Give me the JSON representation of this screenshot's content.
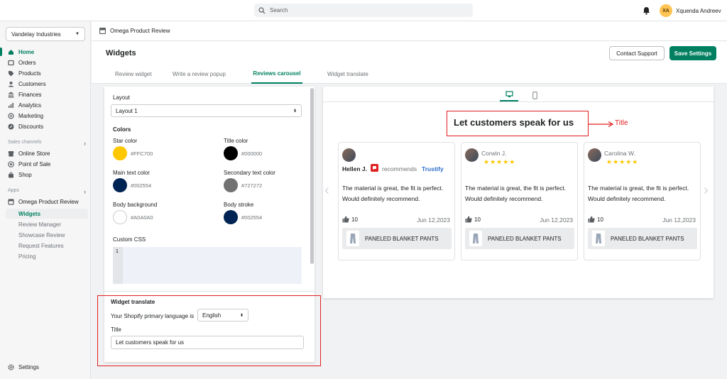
{
  "topbar": {
    "search_placeholder": "Search",
    "avatar_initials": "XA",
    "user_name": "Xquenda Andreev"
  },
  "sidebar": {
    "store": "Vandelay Industries",
    "items": [
      {
        "label": "Home",
        "icon": "home-icon"
      },
      {
        "label": "Orders",
        "icon": "orders-icon"
      },
      {
        "label": "Products",
        "icon": "tag-icon"
      },
      {
        "label": "Customers",
        "icon": "person-icon"
      },
      {
        "label": "Finances",
        "icon": "bank-icon"
      },
      {
        "label": "Analytics",
        "icon": "chart-icon"
      },
      {
        "label": "Marketing",
        "icon": "target-icon"
      },
      {
        "label": "Discounts",
        "icon": "discount-icon"
      }
    ],
    "sales_channels_label": "Sales channels",
    "channels": [
      {
        "label": "Online Store"
      },
      {
        "label": "Point of Sale"
      },
      {
        "label": "Shop"
      }
    ],
    "apps_label": "Apps",
    "app": "Omega Product Review",
    "app_items": [
      {
        "label": "Widgets"
      },
      {
        "label": "Review Manager"
      },
      {
        "label": "Showcase Review"
      },
      {
        "label": "Request Features"
      },
      {
        "label": "Pricing"
      }
    ],
    "settings": "Settings"
  },
  "appbar": {
    "title": "Omega Product Review"
  },
  "header": {
    "title": "Widgets",
    "contact": "Contact Support",
    "save": "Save Settings"
  },
  "tabs": [
    "Review widget",
    "Write a review popup",
    "Reviews carousel",
    "Widget translate"
  ],
  "settings": {
    "layout_label": "Layout",
    "layout_value": "Layout 1",
    "colors_label": "Colors",
    "colors": [
      {
        "label": "Star color",
        "hex": "#FFC700"
      },
      {
        "label": "Title color",
        "hex": "#000000"
      },
      {
        "label": "Main text color",
        "hex": "#002554"
      },
      {
        "label": "Secondary text color",
        "hex": "#727272"
      },
      {
        "label": "Body background",
        "hex": "#A0A0A0"
      },
      {
        "label": "Body stroke",
        "hex": "#002554"
      }
    ],
    "css_label": "Custom CSS",
    "css_line": "1",
    "translate_label": "Widget translate",
    "language_label": "Your Shopify primary language is",
    "language_value": "English",
    "title_label": "Title",
    "title_value": "Let customers speak for us"
  },
  "preview": {
    "title": "Let customers speak for us",
    "annotation": "Title",
    "cards": [
      {
        "name": "Hellen J.",
        "recommends": "recommends",
        "brand": "Trustify",
        "text": "The material is great, the fit is perfect. Would definitely recommend.",
        "likes": "10",
        "date": "Jun 12,2023",
        "product": "PANELED BLANKET PANTS"
      },
      {
        "name": "Corwin J.",
        "stars": "★★★★★",
        "text": "The material is great, the fit is perfect. Would definitely recommend.",
        "likes": "10",
        "date": "Jun 12,2023",
        "product": "PANELED BLANKET PANTS"
      },
      {
        "name": "Carolina W.",
        "stars": "★★★★★",
        "text": "The material is great, the fit is perfect. Would definitely recommend.",
        "likes": "10",
        "date": "Jun 12,2023",
        "product": "PANELED BLANKET PANTS"
      }
    ]
  },
  "colors": {
    "accent": "#008060",
    "annotation": "#E02020",
    "link": "#2c6ecb"
  }
}
